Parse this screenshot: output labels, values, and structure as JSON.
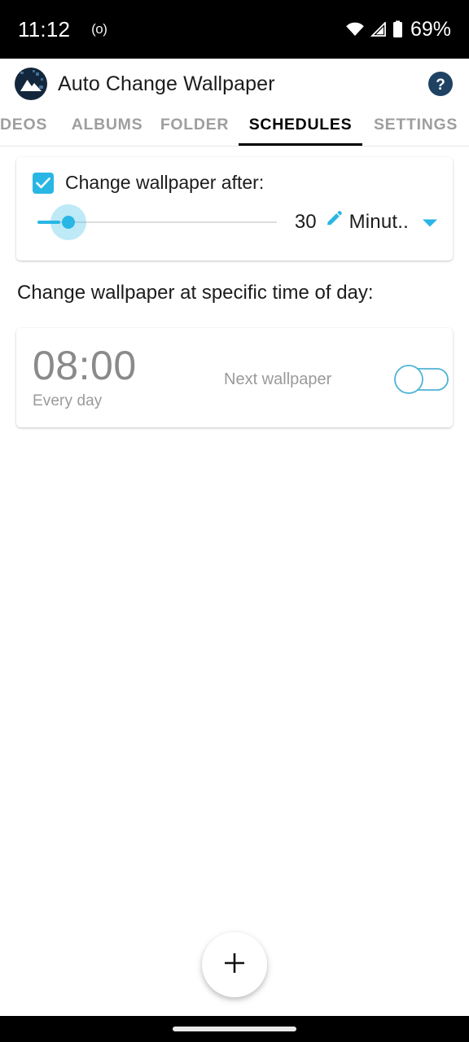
{
  "status_bar": {
    "clock": "11:12",
    "cast_indicator": "(o)",
    "battery_percent": "69%",
    "icons": [
      "wifi-icon",
      "cellular-signal-icon",
      "battery-icon"
    ]
  },
  "app_bar": {
    "logo": "mountain-app-logo",
    "title": "Auto Change Wallpaper",
    "help_icon": "help-circle-icon"
  },
  "tabs": {
    "items": [
      {
        "label": "DEOS",
        "active": false
      },
      {
        "label": "ALBUMS",
        "active": false
      },
      {
        "label": "FOLDER",
        "active": false
      },
      {
        "label": "SCHEDULES",
        "active": true
      },
      {
        "label": "SETTINGS",
        "active": false
      }
    ]
  },
  "interval_card": {
    "checkbox_checked": true,
    "checkbox_label": "Change wallpaper after:",
    "slider": {
      "value": 30,
      "min": 1,
      "max": 600,
      "fill_percent": 8
    },
    "value": "30",
    "edit_icon": "pencil-icon",
    "unit": "Minut..",
    "dropdown_icon": "chevron-down-icon"
  },
  "section": {
    "title": "Change wallpaper at specific time of day:"
  },
  "schedule_card": {
    "time": "08:00",
    "repeat": "Every day",
    "action": "Next wallpaper",
    "enabled": false
  },
  "fab": {
    "icon": "plus-icon",
    "label": "+"
  },
  "nav_bar": {
    "gesture_pill": "home-gesture-pill"
  },
  "colors": {
    "accent": "#29b6e5",
    "logo_navy": "#13273c",
    "text_primary": "#1c1c1c",
    "text_muted": "#9a9a9a",
    "tab_inactive": "#9e9e9e"
  }
}
